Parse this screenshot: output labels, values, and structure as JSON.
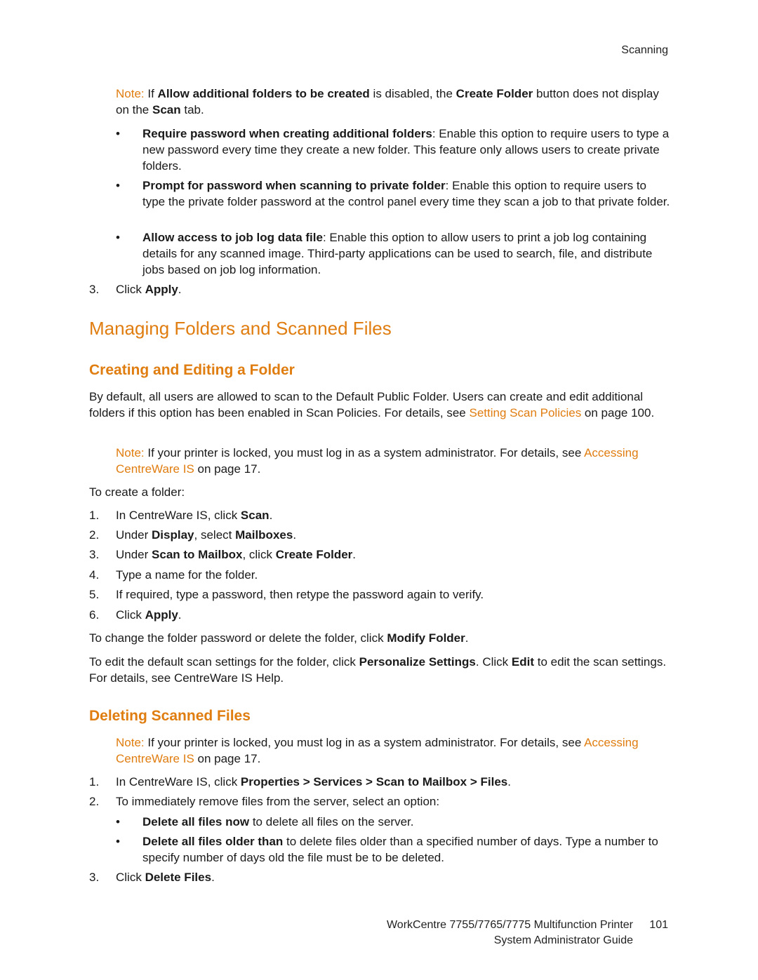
{
  "header": {
    "section": "Scanning"
  },
  "top_note": {
    "label": "Note:",
    "t1": " If ",
    "b1": "Allow additional folders to be created",
    "t2": " is disabled, the ",
    "b2": "Create Folder",
    "t3": " button does not display on the ",
    "b3": "Scan",
    "t4": " tab."
  },
  "options": [
    {
      "title": "Require password when creating additional folders",
      "text": ": Enable this option to require users to type a new password every time they create a new folder. This feature only allows users to create private folders."
    },
    {
      "title": "Prompt for password when scanning to private folder",
      "text": ": Enable this option to require users to type the private folder password at the control panel every time they scan a job to that private folder."
    },
    {
      "title": "Allow access to job log data file",
      "text": ": Enable this option to allow users to print a job log containing details for any scanned image. Third-party applications can be used to search, file, and distribute jobs based on job log information."
    }
  ],
  "step3_top": {
    "num": "3.",
    "t1": "Click ",
    "b1": "Apply",
    "t2": "."
  },
  "h1": "Managing Folders and Scanned Files",
  "creating": {
    "heading": "Creating and Editing a Folder",
    "intro": "By default, all users are allowed to scan to the Default Public Folder. Users can create and edit additional folders if this option has been enabled in Scan Policies. For details, see ",
    "intro_link": "Setting Scan Policies",
    "intro_end": " on page 100.",
    "note_label": "Note:",
    "note_text": " If your printer is locked, you must log in as a system administrator. For details, see ",
    "note_link": "Accessing CentreWare IS",
    "note_end": " on page 17.",
    "lead": "To create a folder:",
    "steps": [
      {
        "num": "1.",
        "t1": "In CentreWare IS, click ",
        "b1": "Scan",
        "t2": ".",
        "b2": "",
        "t3": ""
      },
      {
        "num": "2.",
        "t1": "Under ",
        "b1": "Display",
        "t2": ", select ",
        "b2": "Mailboxes",
        "t3": "."
      },
      {
        "num": "3.",
        "t1": "Under ",
        "b1": "Scan to Mailbox",
        "t2": ", click ",
        "b2": "Create Folder",
        "t3": "."
      },
      {
        "num": "4.",
        "t1": "Type a name for the folder.",
        "b1": "",
        "t2": "",
        "b2": "",
        "t3": ""
      },
      {
        "num": "5.",
        "t1": "If required, type a password, then retype the password again to verify.",
        "b1": "",
        "t2": "",
        "b2": "",
        "t3": ""
      },
      {
        "num": "6.",
        "t1": "Click ",
        "b1": "Apply",
        "t2": ".",
        "b2": "",
        "t3": ""
      }
    ],
    "modify": {
      "t1": "To change the folder password or delete the folder, click ",
      "b1": "Modify Folder",
      "t2": "."
    },
    "personalize": {
      "t1": "To edit the default scan settings for the folder, click ",
      "b1": "Personalize Settings",
      "t2": ". Click ",
      "b2": "Edit",
      "t3": " to edit the scan settings. For details, see CentreWare IS Help."
    }
  },
  "deleting": {
    "heading": "Deleting Scanned Files",
    "note_label": "Note:",
    "note_text": " If your printer is locked, you must log in as a system administrator. For details, see ",
    "note_link": "Accessing CentreWare IS",
    "note_end": " on page 17.",
    "step1": {
      "num": "1.",
      "t1": "In CentreWare IS, click ",
      "b1": "Properties > Services > Scan to Mailbox > Files",
      "t2": "."
    },
    "step2": {
      "num": "2.",
      "t1": "To immediately remove files from the server, select an option:"
    },
    "options": [
      {
        "title": "Delete all files now",
        "text": " to delete all files on the server."
      },
      {
        "title": "Delete all files older than",
        "text": " to delete files older than a specified number of days. Type a number to specify number of days old the file must be to be deleted."
      }
    ],
    "step3": {
      "num": "3.",
      "t1": "Click ",
      "b1": "Delete Files",
      "t2": "."
    }
  },
  "footer": {
    "product": "WorkCentre 7755/7765/7775 Multifunction Printer",
    "page": "101",
    "guide": "System Administrator Guide"
  }
}
